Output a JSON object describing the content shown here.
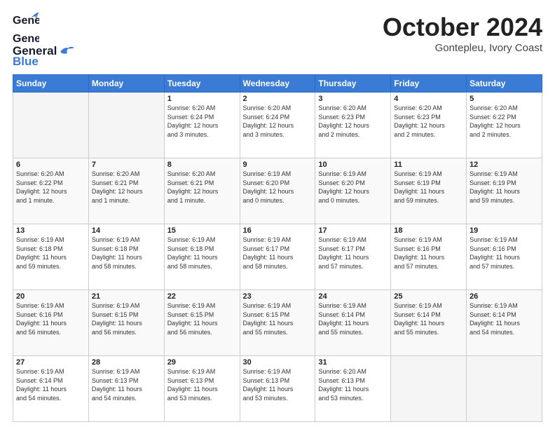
{
  "header": {
    "logo_general": "General",
    "logo_blue": "Blue",
    "month_title": "October 2024",
    "subtitle": "Gontepleu, Ivory Coast"
  },
  "days_of_week": [
    "Sunday",
    "Monday",
    "Tuesday",
    "Wednesday",
    "Thursday",
    "Friday",
    "Saturday"
  ],
  "weeks": [
    [
      {
        "day": "",
        "info": ""
      },
      {
        "day": "",
        "info": ""
      },
      {
        "day": "1",
        "info": "Sunrise: 6:20 AM\nSunset: 6:24 PM\nDaylight: 12 hours\nand 3 minutes."
      },
      {
        "day": "2",
        "info": "Sunrise: 6:20 AM\nSunset: 6:24 PM\nDaylight: 12 hours\nand 3 minutes."
      },
      {
        "day": "3",
        "info": "Sunrise: 6:20 AM\nSunset: 6:23 PM\nDaylight: 12 hours\nand 2 minutes."
      },
      {
        "day": "4",
        "info": "Sunrise: 6:20 AM\nSunset: 6:23 PM\nDaylight: 12 hours\nand 2 minutes."
      },
      {
        "day": "5",
        "info": "Sunrise: 6:20 AM\nSunset: 6:22 PM\nDaylight: 12 hours\nand 2 minutes."
      }
    ],
    [
      {
        "day": "6",
        "info": "Sunrise: 6:20 AM\nSunset: 6:22 PM\nDaylight: 12 hours\nand 1 minute."
      },
      {
        "day": "7",
        "info": "Sunrise: 6:20 AM\nSunset: 6:21 PM\nDaylight: 12 hours\nand 1 minute."
      },
      {
        "day": "8",
        "info": "Sunrise: 6:20 AM\nSunset: 6:21 PM\nDaylight: 12 hours\nand 1 minute."
      },
      {
        "day": "9",
        "info": "Sunrise: 6:19 AM\nSunset: 6:20 PM\nDaylight: 12 hours\nand 0 minutes."
      },
      {
        "day": "10",
        "info": "Sunrise: 6:19 AM\nSunset: 6:20 PM\nDaylight: 12 hours\nand 0 minutes."
      },
      {
        "day": "11",
        "info": "Sunrise: 6:19 AM\nSunset: 6:19 PM\nDaylight: 11 hours\nand 59 minutes."
      },
      {
        "day": "12",
        "info": "Sunrise: 6:19 AM\nSunset: 6:19 PM\nDaylight: 11 hours\nand 59 minutes."
      }
    ],
    [
      {
        "day": "13",
        "info": "Sunrise: 6:19 AM\nSunset: 6:18 PM\nDaylight: 11 hours\nand 59 minutes."
      },
      {
        "day": "14",
        "info": "Sunrise: 6:19 AM\nSunset: 6:18 PM\nDaylight: 11 hours\nand 58 minutes."
      },
      {
        "day": "15",
        "info": "Sunrise: 6:19 AM\nSunset: 6:18 PM\nDaylight: 11 hours\nand 58 minutes."
      },
      {
        "day": "16",
        "info": "Sunrise: 6:19 AM\nSunset: 6:17 PM\nDaylight: 11 hours\nand 58 minutes."
      },
      {
        "day": "17",
        "info": "Sunrise: 6:19 AM\nSunset: 6:17 PM\nDaylight: 11 hours\nand 57 minutes."
      },
      {
        "day": "18",
        "info": "Sunrise: 6:19 AM\nSunset: 6:16 PM\nDaylight: 11 hours\nand 57 minutes."
      },
      {
        "day": "19",
        "info": "Sunrise: 6:19 AM\nSunset: 6:16 PM\nDaylight: 11 hours\nand 57 minutes."
      }
    ],
    [
      {
        "day": "20",
        "info": "Sunrise: 6:19 AM\nSunset: 6:16 PM\nDaylight: 11 hours\nand 56 minutes."
      },
      {
        "day": "21",
        "info": "Sunrise: 6:19 AM\nSunset: 6:15 PM\nDaylight: 11 hours\nand 56 minutes."
      },
      {
        "day": "22",
        "info": "Sunrise: 6:19 AM\nSunset: 6:15 PM\nDaylight: 11 hours\nand 56 minutes."
      },
      {
        "day": "23",
        "info": "Sunrise: 6:19 AM\nSunset: 6:15 PM\nDaylight: 11 hours\nand 55 minutes."
      },
      {
        "day": "24",
        "info": "Sunrise: 6:19 AM\nSunset: 6:14 PM\nDaylight: 11 hours\nand 55 minutes."
      },
      {
        "day": "25",
        "info": "Sunrise: 6:19 AM\nSunset: 6:14 PM\nDaylight: 11 hours\nand 55 minutes."
      },
      {
        "day": "26",
        "info": "Sunrise: 6:19 AM\nSunset: 6:14 PM\nDaylight: 11 hours\nand 54 minutes."
      }
    ],
    [
      {
        "day": "27",
        "info": "Sunrise: 6:19 AM\nSunset: 6:14 PM\nDaylight: 11 hours\nand 54 minutes."
      },
      {
        "day": "28",
        "info": "Sunrise: 6:19 AM\nSunset: 6:13 PM\nDaylight: 11 hours\nand 54 minutes."
      },
      {
        "day": "29",
        "info": "Sunrise: 6:19 AM\nSunset: 6:13 PM\nDaylight: 11 hours\nand 53 minutes."
      },
      {
        "day": "30",
        "info": "Sunrise: 6:19 AM\nSunset: 6:13 PM\nDaylight: 11 hours\nand 53 minutes."
      },
      {
        "day": "31",
        "info": "Sunrise: 6:20 AM\nSunset: 6:13 PM\nDaylight: 11 hours\nand 53 minutes."
      },
      {
        "day": "",
        "info": ""
      },
      {
        "day": "",
        "info": ""
      }
    ]
  ]
}
